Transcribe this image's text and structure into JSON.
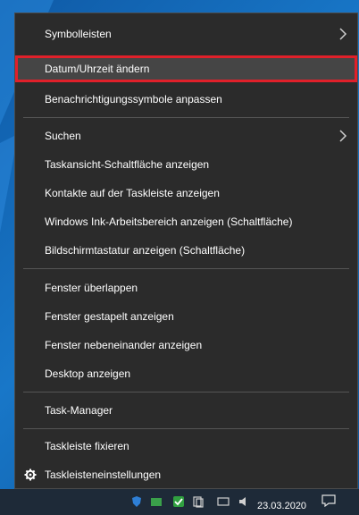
{
  "menu": {
    "items": [
      {
        "label": "Symbolleisten",
        "has_submenu": true
      },
      {
        "label": "Datum/Uhrzeit ändern",
        "highlighted": true
      },
      {
        "label": "Benachrichtigungssymbole anpassen"
      },
      {
        "label": "Suchen",
        "has_submenu": true
      },
      {
        "label": "Taskansicht-Schaltfläche anzeigen"
      },
      {
        "label": "Kontakte auf der Taskleiste anzeigen"
      },
      {
        "label": "Windows Ink-Arbeitsbereich anzeigen (Schaltfläche)"
      },
      {
        "label": "Bildschirmtastatur anzeigen (Schaltfläche)"
      },
      {
        "label": "Fenster überlappen"
      },
      {
        "label": "Fenster gestapelt anzeigen"
      },
      {
        "label": "Fenster nebeneinander anzeigen"
      },
      {
        "label": "Desktop anzeigen"
      },
      {
        "label": "Task-Manager"
      },
      {
        "label": "Taskleiste fixieren"
      },
      {
        "label": "Taskleisteneinstellungen",
        "icon": "gear-icon"
      }
    ]
  },
  "taskbar": {
    "date": "23.03.2020"
  },
  "colors": {
    "menu_bg": "#2b2b2b",
    "highlight_bg": "#454545",
    "highlight_border": "#e0202a"
  }
}
